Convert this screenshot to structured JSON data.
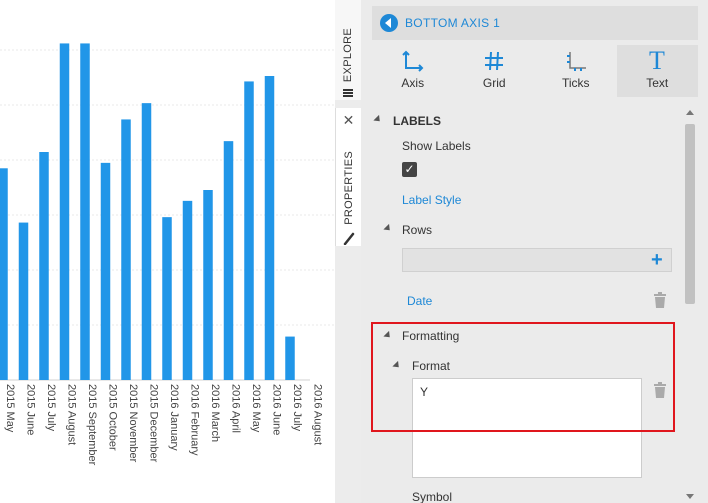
{
  "chart_data": {
    "type": "bar",
    "categories": [
      "2015 May",
      "2015 June",
      "2015 July",
      "2015 August",
      "2015 September",
      "2015 October",
      "2015 November",
      "2015 December",
      "2016 January",
      "2016 February",
      "2016 March",
      "2016 April",
      "2016 May",
      "2016 June",
      "2016 July",
      "2016 August"
    ],
    "values": [
      39,
      29,
      42,
      62,
      62,
      40,
      48,
      51,
      30,
      33,
      35,
      44,
      55,
      56,
      8,
      0
    ],
    "ylim": [
      0,
      70
    ],
    "grid": true,
    "color": "#2196e8"
  },
  "side_tabs": {
    "explore": "EXPLORE",
    "properties": "PROPERTIES",
    "close": "✕"
  },
  "panel": {
    "title": "BOTTOM AXIS 1",
    "tools": [
      {
        "label": "Axis",
        "icon": "axis-icon"
      },
      {
        "label": "Grid",
        "icon": "grid-icon"
      },
      {
        "label": "Ticks",
        "icon": "ticks-icon"
      },
      {
        "label": "Text",
        "icon": "text-icon"
      }
    ],
    "labels_section": "LABELS",
    "show_labels": "Show Labels",
    "show_labels_checked": true,
    "label_style": "Label Style",
    "rows_section": "Rows",
    "rows_item": "Date",
    "formatting_section": "Formatting",
    "format_section": "Format",
    "format_value": "Y",
    "symbol_section": "Symbol"
  },
  "colors": {
    "accent": "#1e88d6",
    "highlight": "#e0161d"
  }
}
